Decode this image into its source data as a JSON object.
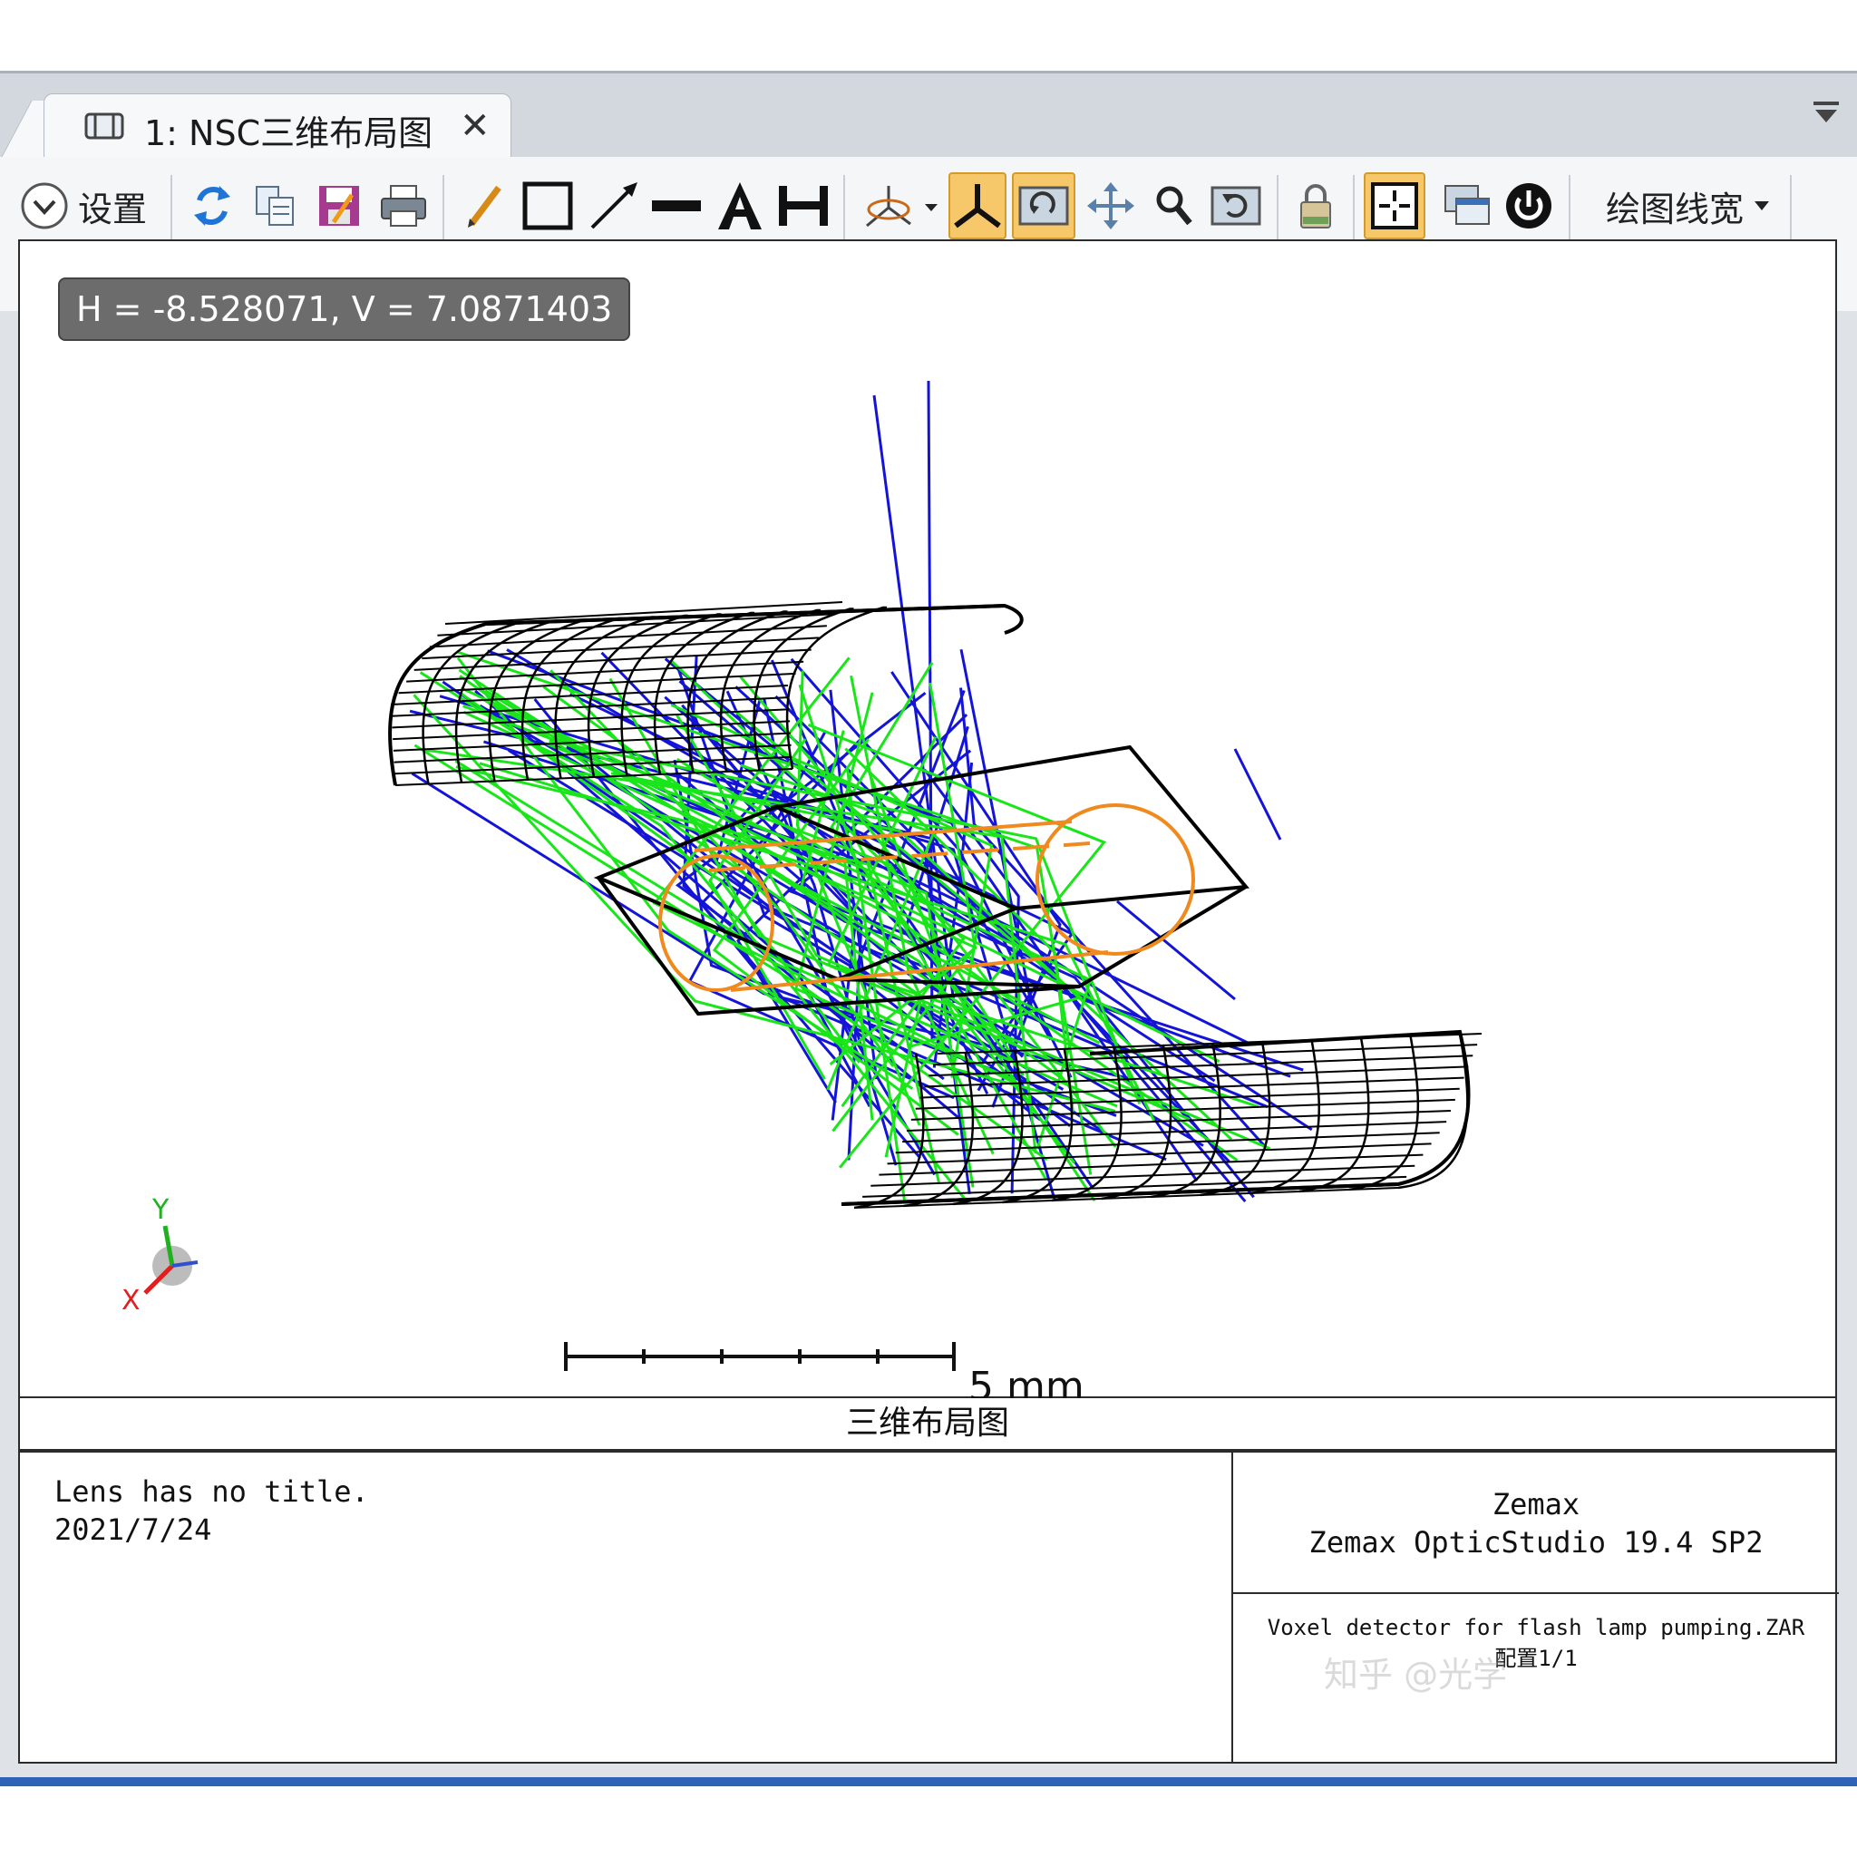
{
  "window": {
    "tab_title": "1: NSC三维布局图",
    "tab_close": "✕"
  },
  "toolbar": {
    "settings_label": "设置",
    "line_width_label": "绘图线宽"
  },
  "plot": {
    "cursor_readout": "H = -8.528071, V = 7.0871403",
    "scale_bar_label": "5 mm",
    "axis_y_label": "Y",
    "axis_x_label": "X",
    "ray_colors": [
      "#1414d8",
      "#19e619"
    ],
    "geometry_color": "#000000",
    "element_color": "#f08a1e"
  },
  "footer": {
    "plot_title": "三维布局图",
    "lens_title": "Lens has no title.",
    "date": "2021/7/24",
    "company": "Zemax",
    "product": "Zemax OpticStudio 19.4 SP2",
    "detector_line1": "Voxel detector for flash lamp pumping.ZAR",
    "detector_line2": "配置1/1"
  },
  "watermark": "知乎 @光学"
}
